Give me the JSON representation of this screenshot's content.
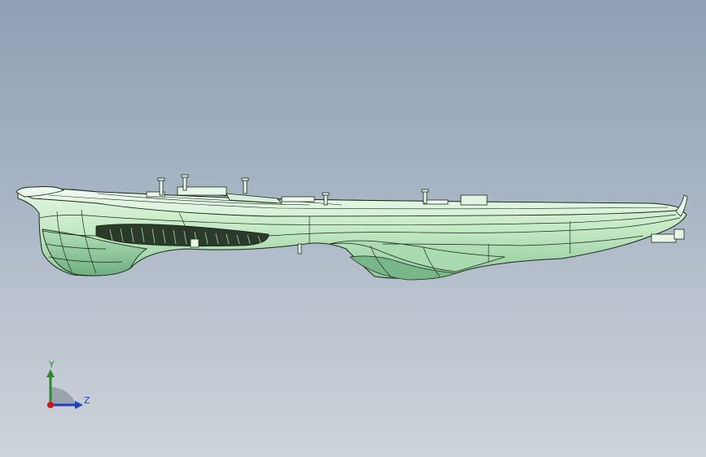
{
  "viewport": {
    "background_top": "#8f9fb4",
    "background_bottom": "#cdd3da",
    "model_color": "#c8ecc8",
    "edge_color": "#1a2a1a"
  },
  "triad": {
    "y_label": "Y",
    "z_label": "Z",
    "y_color": "#2a8a2a",
    "z_color": "#1f3ec0",
    "origin_color": "#d01818"
  }
}
